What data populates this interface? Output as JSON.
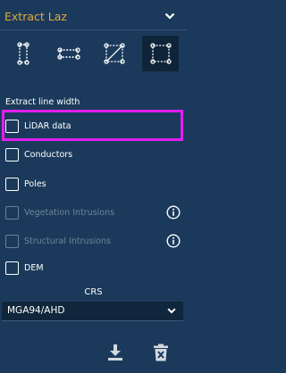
{
  "header": {
    "title": "Extract Laz"
  },
  "tools": [
    {
      "name": "vertical-segment-tool"
    },
    {
      "name": "horizontal-segment-tool"
    },
    {
      "name": "diagonal-box-tool"
    },
    {
      "name": "rectangle-box-tool",
      "active": true
    }
  ],
  "section": {
    "label": "Extract line width"
  },
  "options": [
    {
      "label": "LiDAR data",
      "checked": false,
      "enabled": true,
      "highlighted": true
    },
    {
      "label": "Conductors",
      "checked": false,
      "enabled": true
    },
    {
      "label": "Poles",
      "checked": false,
      "enabled": true
    },
    {
      "label": "Vegetation Intrusions",
      "checked": false,
      "enabled": false,
      "info": true
    },
    {
      "label": "Structural Intrusions",
      "checked": false,
      "enabled": false,
      "info": true
    },
    {
      "label": "DEM",
      "checked": false,
      "enabled": true
    }
  ],
  "crs": {
    "label": "CRS",
    "value": "MGA94/AHD"
  },
  "footer": {
    "download_icon": "download-icon",
    "delete_icon": "delete-icon"
  },
  "colors": {
    "background": "#1b3a5b",
    "accent": "#e3aa3c",
    "highlight": "#e01ff0"
  }
}
